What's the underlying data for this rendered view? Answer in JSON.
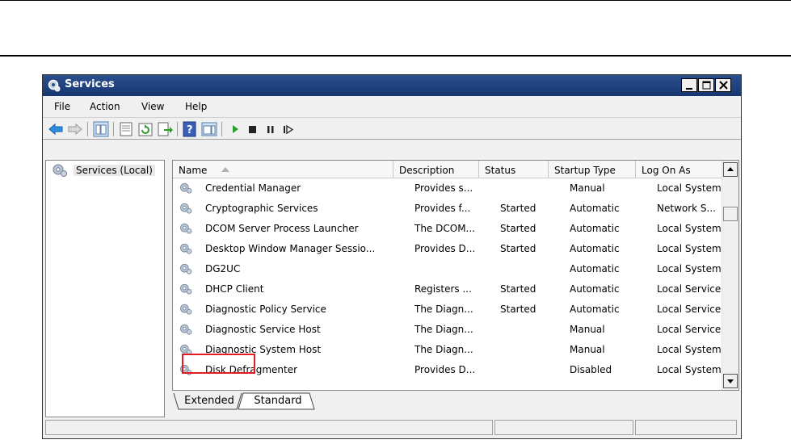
{
  "window": {
    "title": "Services"
  },
  "menu": [
    "File",
    "Action",
    "View",
    "Help"
  ],
  "toolbar_icons": [
    "back-icon",
    "forward-icon",
    "show-hide-console-tree-icon",
    "properties-icon",
    "refresh-icon",
    "export-list-icon",
    "help-icon",
    "show-action-pane-icon",
    "start-service-icon",
    "stop-service-icon",
    "pause-service-icon",
    "resume-service-icon"
  ],
  "tree": {
    "root_label": "Services (Local)"
  },
  "columns": {
    "name": "Name",
    "description": "Description",
    "status": "Status",
    "startup": "Startup Type",
    "logon": "Log On As"
  },
  "services": [
    {
      "name": "Credential Manager",
      "description": "Provides s...",
      "status": "",
      "startup": "Manual",
      "logon": "Local System"
    },
    {
      "name": "Cryptographic Services",
      "description": "Provides f...",
      "status": "Started",
      "startup": "Automatic",
      "logon": "Network S..."
    },
    {
      "name": "DCOM Server Process Launcher",
      "description": "The DCOM...",
      "status": "Started",
      "startup": "Automatic",
      "logon": "Local System"
    },
    {
      "name": "Desktop Window Manager Sessio...",
      "description": "Provides D...",
      "status": "Started",
      "startup": "Automatic",
      "logon": "Local System"
    },
    {
      "name": "DG2UC",
      "description": "",
      "status": "",
      "startup": "Automatic",
      "logon": "Local System"
    },
    {
      "name": "DHCP Client",
      "description": "Registers ...",
      "status": "Started",
      "startup": "Automatic",
      "logon": "Local Service"
    },
    {
      "name": "Diagnostic Policy Service",
      "description": "The Diagn...",
      "status": "Started",
      "startup": "Automatic",
      "logon": "Local Service"
    },
    {
      "name": "Diagnostic Service Host",
      "description": "The Diagn...",
      "status": "",
      "startup": "Manual",
      "logon": "Local Service"
    },
    {
      "name": "Diagnostic System Host",
      "description": "The Diagn...",
      "status": "",
      "startup": "Manual",
      "logon": "Local System"
    },
    {
      "name": "Disk Defragmenter",
      "description": "Provides D...",
      "status": "",
      "startup": "Disabled",
      "logon": "Local System"
    }
  ],
  "highlighted_service": "DG2UC",
  "tabs": [
    {
      "label": "Extended",
      "active": false
    },
    {
      "label": "Standard",
      "active": true
    }
  ],
  "colors": {
    "titlebar": "#1f3f7c",
    "highlight_box": "#e31b23",
    "play_green": "#2a9d2a"
  }
}
